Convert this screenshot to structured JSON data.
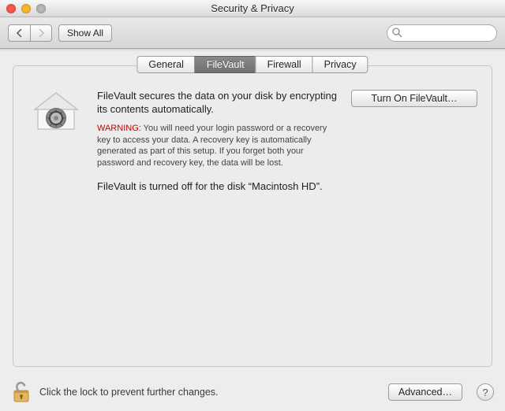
{
  "window": {
    "title": "Security & Privacy"
  },
  "toolbar": {
    "show_all_label": "Show All",
    "search_placeholder": ""
  },
  "tabs": {
    "general": "General",
    "filevault": "FileVault",
    "firewall": "Firewall",
    "privacy": "Privacy",
    "active": "filevault"
  },
  "filevault": {
    "heading": "FileVault secures the data on your disk by encrypting its contents automatically.",
    "warning_label": "WARNING:",
    "warning_body": " You will need your login password or a recovery key to access your data. A recovery key is automatically generated as part of this setup. If you forget both your password and recovery key, the data will be lost.",
    "status": "FileVault is turned off for the disk “Macintosh HD”.",
    "turn_on_label": "Turn On FileVault…"
  },
  "footer": {
    "lock_text": "Click the lock to prevent further changes.",
    "advanced_label": "Advanced…"
  }
}
